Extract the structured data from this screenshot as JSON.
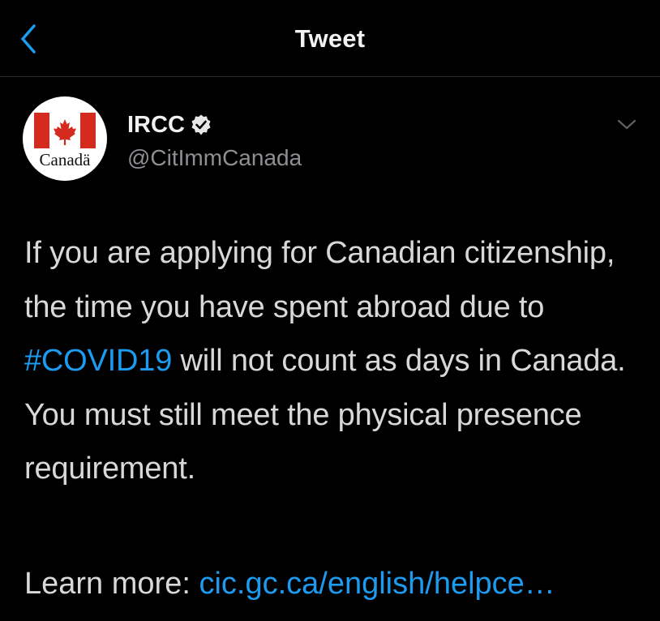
{
  "header": {
    "title": "Tweet",
    "back_icon": "chevron-left-icon"
  },
  "author": {
    "display_name": "IRCC",
    "handle": "@CitImmCanada",
    "verified": true,
    "avatar_wordmark": "Canadä"
  },
  "tweet": {
    "text_before": "If you are applying for Canadian citizenship, the time you have spent abroad due to ",
    "hashtag": "#COVID19",
    "text_after": " will not count as days in Canada. You must still meet the physical presence requirement.",
    "learn_more_label": "Learn more: ",
    "link_text": "cic.gc.ca/english/helpce…"
  },
  "colors": {
    "background": "#000000",
    "accent": "#1d9bf0",
    "text": "#d8d8d8",
    "muted": "#8e8e93",
    "flag_red": "#d52b1e"
  }
}
